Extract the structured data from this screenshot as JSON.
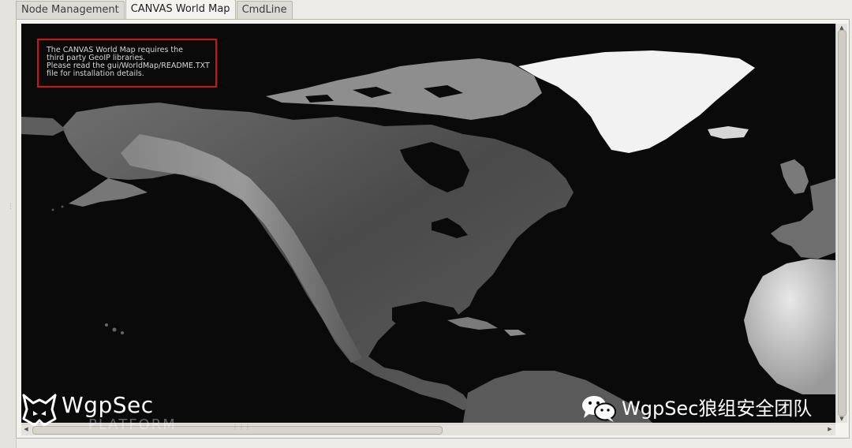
{
  "tabs": [
    {
      "label": "Node Management",
      "active": false
    },
    {
      "label": "CANVAS World Map",
      "active": true
    },
    {
      "label": "CmdLine",
      "active": false
    }
  ],
  "notice": {
    "lines": [
      "The CANVAS World Map requires the",
      "third party GeoIP libraries.",
      "Please read the gui/WorldMap/README.TXT",
      "file for installation details."
    ],
    "border_color": "#d01414"
  },
  "watermark": {
    "brand": "WgpSec",
    "platform": "PLATFORM",
    "wechat_label": "WgpSec狼组安全团队",
    "icons": [
      "wolf-logo-icon",
      "wechat-icon"
    ]
  },
  "colors": {
    "map_background": "#0a0a0a",
    "land_light": "#bdbdbd",
    "greenland": "#f2f2f2"
  }
}
